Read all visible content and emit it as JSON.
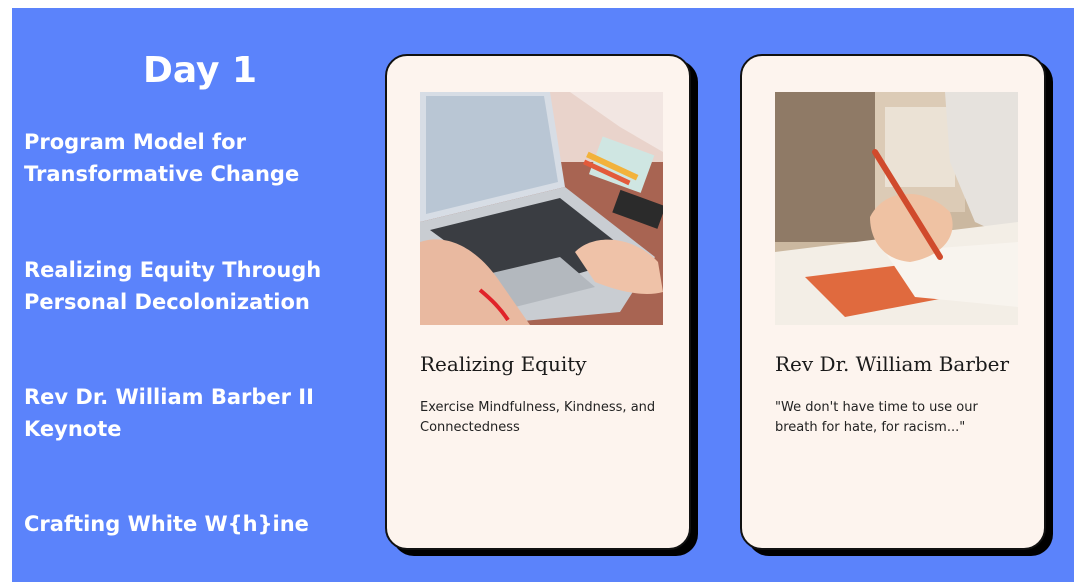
{
  "day_title": "Day 1",
  "agenda": [
    {
      "line1": "Program Model for",
      "line2": "Transformative Change"
    },
    {
      "line1": "Realizing Equity Through",
      "line2": "Personal Decolonization"
    },
    {
      "line1": "Rev Dr. William Barber II",
      "line2": "Keynote"
    },
    {
      "line1": "Crafting White W{h}ine",
      "line2": ""
    }
  ],
  "cards": [
    {
      "image": "laptop-typing-photo",
      "title": "Realizing Equity",
      "body": "Exercise Mindfulness, Kindness, and Connectedness"
    },
    {
      "image": "pen-writing-notebook-photo",
      "title": "Rev Dr. William Barber",
      "body": "\"We don't have time to use our breath for hate, for racism...\""
    }
  ],
  "colors": {
    "background": "#5b83fb",
    "card": "#fdf4ee",
    "card_shadow": "#000000",
    "text_light": "#ffffff"
  }
}
